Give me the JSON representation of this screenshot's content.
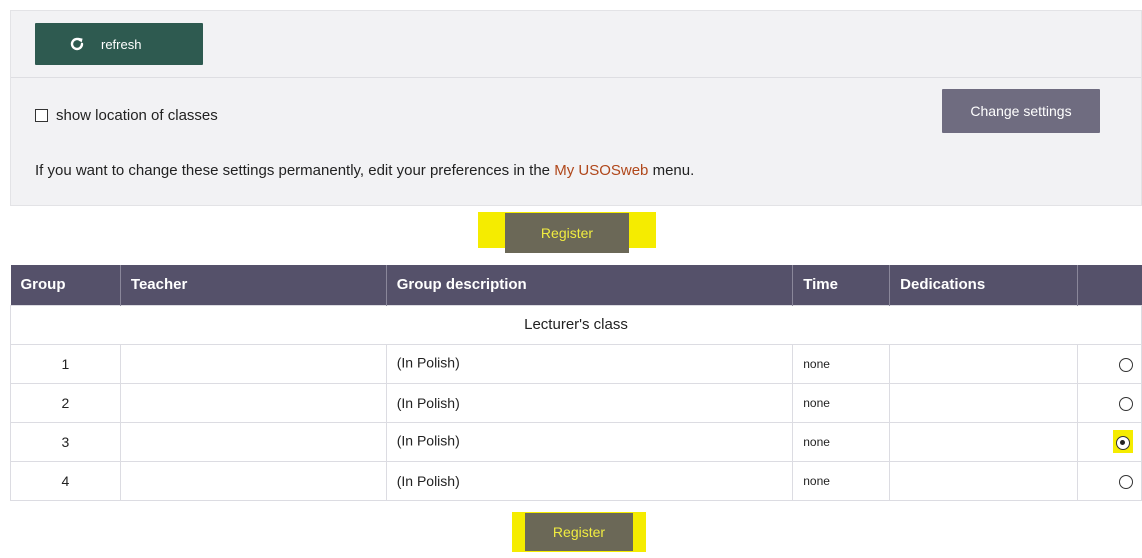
{
  "toolbar": {
    "refresh_label": "refresh"
  },
  "settings": {
    "show_location_label": "show location of classes",
    "show_location_checked": false,
    "change_settings_label": "Change settings",
    "info_prefix": "If you want to change these settings permanently, edit your preferences in the ",
    "info_link": "My USOSweb",
    "info_suffix": " menu."
  },
  "register": {
    "top_label": "Register",
    "bottom_label": "Register"
  },
  "table": {
    "headers": [
      "Group",
      "Teacher",
      "Group description",
      "Time",
      "Dedications",
      ""
    ],
    "section_title": "Lecturer's class",
    "rows": [
      {
        "group": "1",
        "teacher": "",
        "description": "(In Polish)",
        "time": "none",
        "dedications": "",
        "selected": false
      },
      {
        "group": "2",
        "teacher": "",
        "description": "(In Polish)",
        "time": "none",
        "dedications": "",
        "selected": false
      },
      {
        "group": "3",
        "teacher": "",
        "description": "(In Polish)",
        "time": "none",
        "dedications": "",
        "selected": true
      },
      {
        "group": "4",
        "teacher": "",
        "description": "(In Polish)",
        "time": "none",
        "dedications": "",
        "selected": false
      }
    ]
  },
  "colors": {
    "refresh_bg": "#2e5a50",
    "change_settings_bg": "#6f6c80",
    "header_bg": "#55516a",
    "highlight": "#f5ec00",
    "link": "#b0471a"
  }
}
